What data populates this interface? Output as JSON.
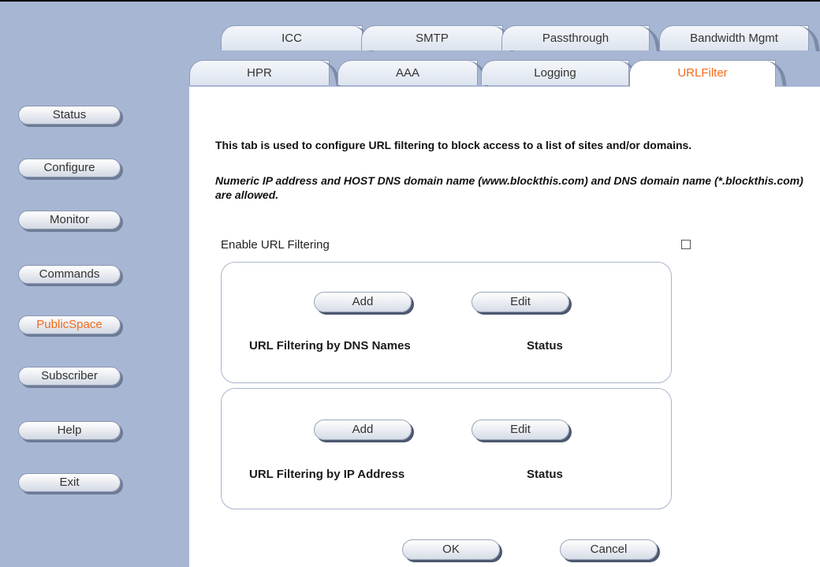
{
  "tabs_back": [
    {
      "label": "ICC"
    },
    {
      "label": "SMTP"
    },
    {
      "label": "Passthrough"
    },
    {
      "label": "Bandwidth Mgmt"
    }
  ],
  "tabs_front": [
    {
      "label": "HPR"
    },
    {
      "label": "AAA"
    },
    {
      "label": "Logging"
    },
    {
      "label": "URLFilter",
      "active": true
    }
  ],
  "nav": [
    {
      "label": "Status"
    },
    {
      "label": "Configure"
    },
    {
      "label": "Monitor"
    },
    {
      "label": "Commands"
    },
    {
      "label": "PublicSpace",
      "active": true
    },
    {
      "label": "Subscriber"
    },
    {
      "label": "Help"
    },
    {
      "label": "Exit"
    }
  ],
  "content": {
    "intro": "This tab is used to configure URL filtering to block access to a list of sites and/or domains.",
    "note": "Numeric IP address and HOST DNS domain name (www.blockthis.com) and DNS domain name (*.blockthis.com) are allowed.",
    "enable_label": "Enable URL Filtering",
    "enable_checked": false
  },
  "dns_group": {
    "add_label": "Add",
    "edit_label": "Edit",
    "title": "URL Filtering by DNS Names",
    "status_label": "Status"
  },
  "ip_group": {
    "add_label": "Add",
    "edit_label": "Edit",
    "title": "URL Filtering by IP Address",
    "status_label": "Status"
  },
  "footer": {
    "ok_label": "OK",
    "cancel_label": "Cancel"
  },
  "colors": {
    "accent": "#f26a1b",
    "sidebar_bg": "#a7b6d3",
    "content_bg": "#ffffff"
  }
}
